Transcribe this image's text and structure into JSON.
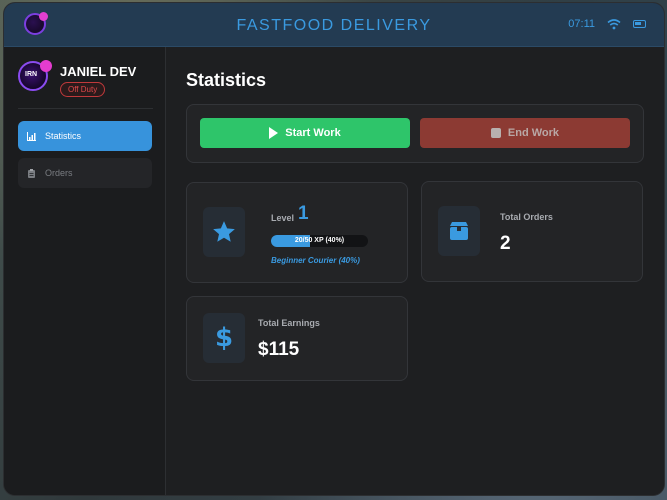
{
  "app": {
    "title": "FASTFOOD DELIVERY",
    "time": "07:11"
  },
  "icons": {
    "app_logo": "app-logo-icon",
    "wifi": "wifi-icon",
    "battery": "battery-icon"
  },
  "colors": {
    "accent": "#3a9ae0",
    "start": "#2ec56a",
    "end": "#8c3a33",
    "off_duty": "#e0494b"
  },
  "profile": {
    "avatar_text": "IRN",
    "name": "JANIEL DEV",
    "status": "Off Duty"
  },
  "sidebar": {
    "items": [
      {
        "label": "Statistics",
        "icon": "chart-icon",
        "active": true
      },
      {
        "label": "Orders",
        "icon": "clipboard-icon",
        "active": false
      }
    ]
  },
  "main": {
    "title": "Statistics",
    "start_label": "Start Work",
    "end_label": "End Work",
    "level": {
      "label": "Level",
      "value": "1",
      "xp_text": "20/50 XP (40%)",
      "xp_fraction": 0.4,
      "rank": "Beginner Courier (40%)",
      "icon": "star-icon"
    },
    "orders": {
      "label": "Total Orders",
      "value": "2",
      "icon": "box-icon"
    },
    "earnings": {
      "label": "Total Earnings",
      "value": "$115",
      "icon": "dollar-icon"
    }
  }
}
